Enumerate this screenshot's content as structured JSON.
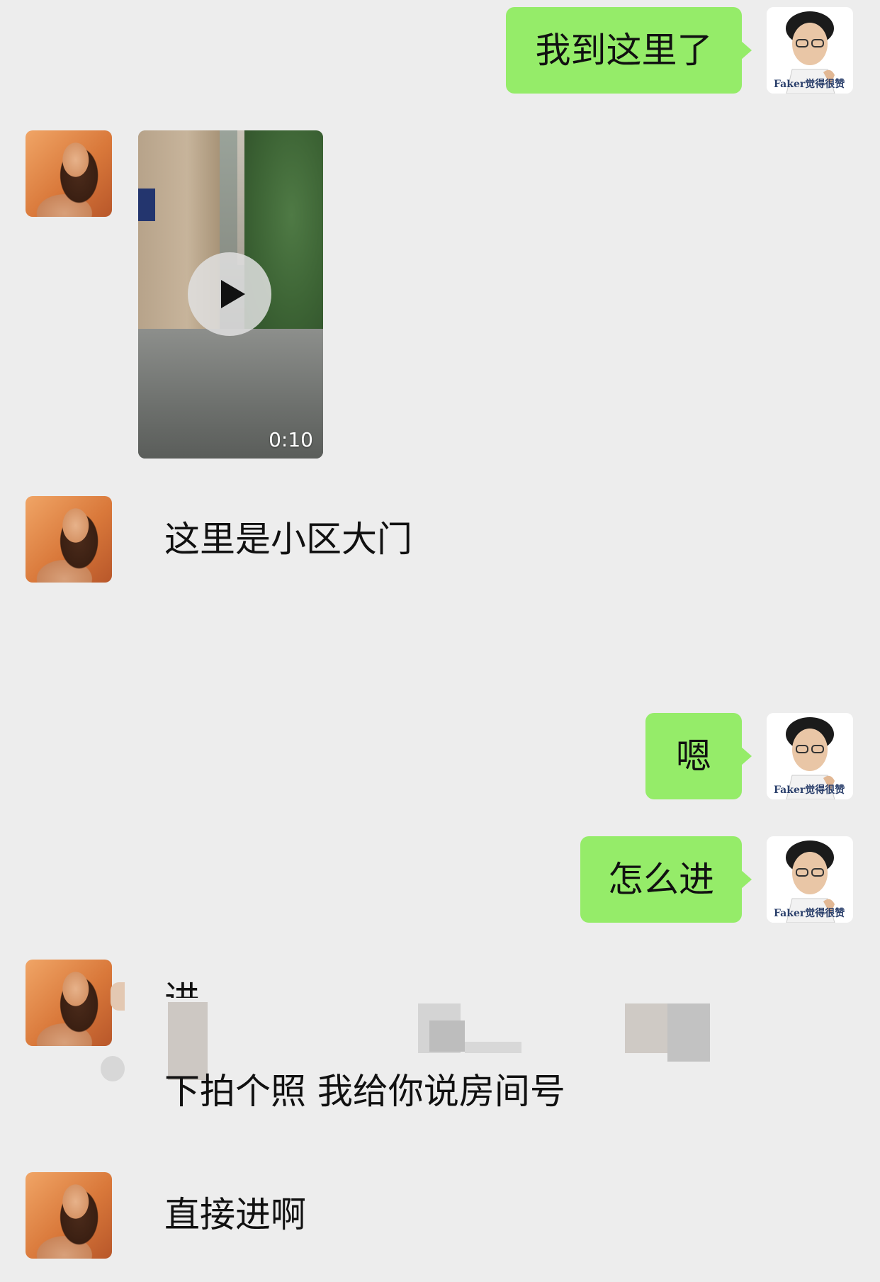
{
  "messages": [
    {
      "from": "me",
      "type": "text",
      "text": "我到这里了"
    },
    {
      "from": "her",
      "type": "video",
      "duration": "0:10"
    },
    {
      "from": "her",
      "type": "text",
      "text": "这里是小区大门"
    },
    {
      "from": "me",
      "type": "text",
      "text": "嗯"
    },
    {
      "from": "me",
      "type": "text",
      "text": "怎么进"
    },
    {
      "from": "her",
      "type": "text",
      "text_top": "进",
      "text": "下拍个照 我给你说房间号"
    },
    {
      "from": "her",
      "type": "text",
      "text": "直接进啊"
    }
  ],
  "my_avatar": {
    "caption": "Faker觉得很赞"
  },
  "colors": {
    "background": "#ededed",
    "my_bubble": "#95ec69"
  }
}
